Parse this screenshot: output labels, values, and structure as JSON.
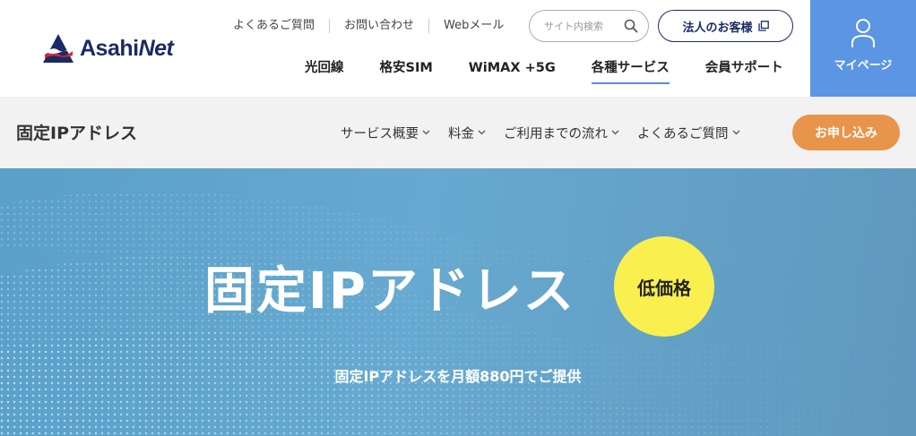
{
  "brand": {
    "name_a": "Asahi",
    "name_b": "Net"
  },
  "util_nav": [
    {
      "label": "よくあるご質問"
    },
    {
      "label": "お問い合わせ"
    },
    {
      "label": "Webメール"
    }
  ],
  "search": {
    "placeholder": "サイト内検索"
  },
  "corp_button": {
    "label": "法人のお客様"
  },
  "main_nav": [
    {
      "label": "光回線"
    },
    {
      "label": "格安SIM"
    },
    {
      "label": "WiMAX +5G"
    },
    {
      "label": "各種サービス"
    },
    {
      "label": "会員サポート"
    }
  ],
  "mypage": {
    "label": "マイページ"
  },
  "subheader": {
    "title": "固定IPアドレス",
    "nav": [
      {
        "label": "サービス概要"
      },
      {
        "label": "料金"
      },
      {
        "label": "ご利用までの流れ"
      },
      {
        "label": "よくあるご質問"
      }
    ],
    "apply_label": "お申し込み"
  },
  "hero": {
    "title": "固定IPアドレス",
    "badge": "低価格",
    "subtitle": "固定IPアドレスを月額880円でご提供"
  },
  "colors": {
    "brand_navy": "#1a2a66",
    "mypage_blue": "#5b95e4",
    "apply_orange": "#e8944a",
    "badge_yellow": "#f9ef4f",
    "hero_blue": "#67a9d0"
  }
}
